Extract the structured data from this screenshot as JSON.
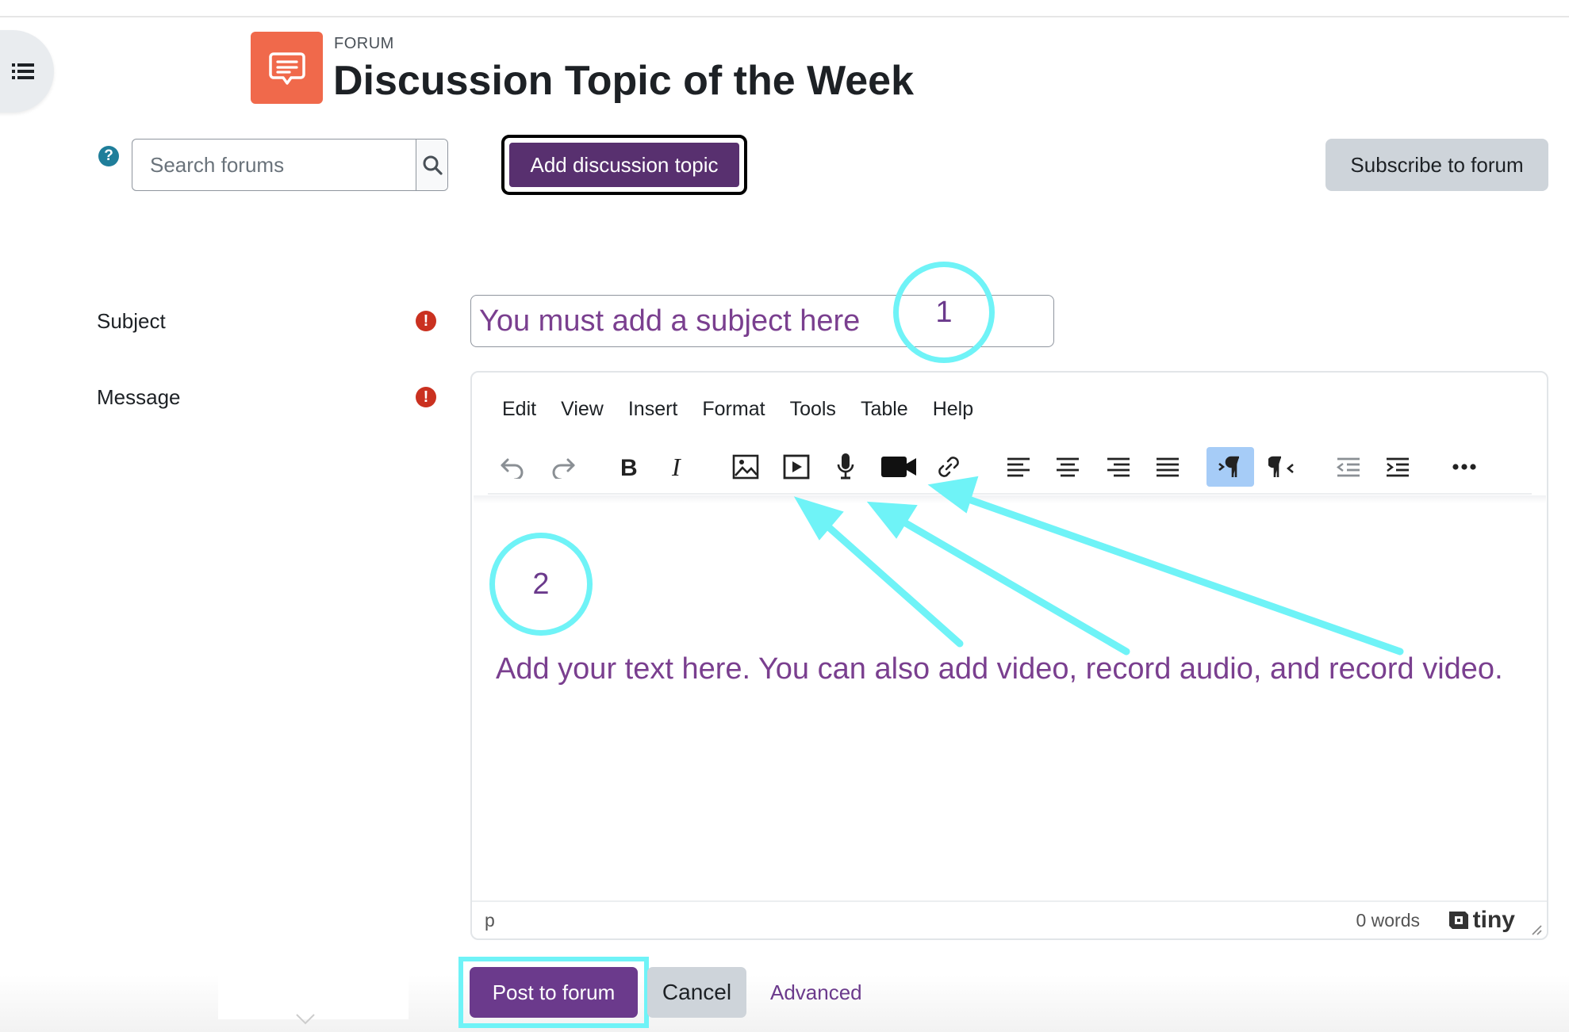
{
  "header": {
    "kicker": "FORUM",
    "title": "Discussion Topic of the Week",
    "icon": "forum-speech-bubble-icon"
  },
  "toolbar": {
    "search_placeholder": "Search forums",
    "add_topic_label": "Add discussion topic",
    "subscribe_label": "Subscribe to forum"
  },
  "form": {
    "subject_label": "Subject",
    "subject_value": "You must add a subject here",
    "message_label": "Message",
    "required_mark": "!"
  },
  "editor": {
    "menu": [
      "Edit",
      "View",
      "Insert",
      "Format",
      "Tools",
      "Table",
      "Help"
    ],
    "body_text": "Add your text here. You can also add video, record audio, and record video.",
    "status_path": "p",
    "word_count": "0 words",
    "brand": "tiny"
  },
  "callouts": {
    "one": "1",
    "two": "2"
  },
  "actions": {
    "post_label": "Post to forum",
    "cancel_label": "Cancel",
    "advanced_label": "Advanced"
  },
  "colors": {
    "primary": "#6b3a8c",
    "add_topic": "#58306f",
    "forum_icon_bg": "#f0694b",
    "annotation": "#6ff3f7",
    "annotation_text": "#7a3f8f",
    "required": "#ca3120"
  }
}
